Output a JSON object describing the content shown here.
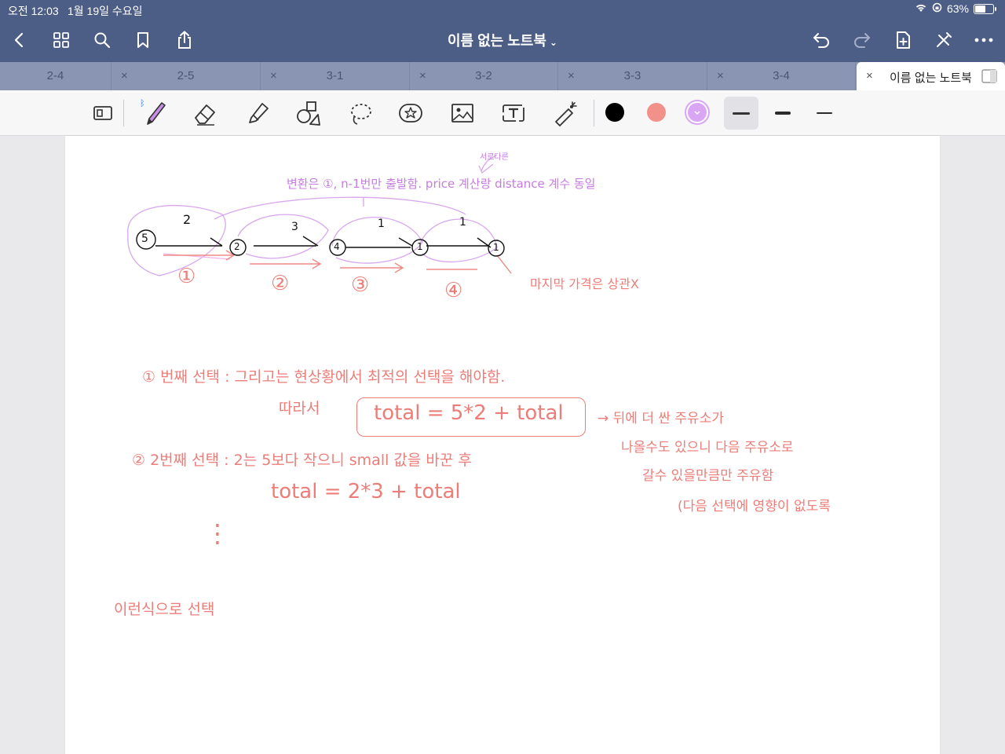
{
  "status_bar": {
    "time": "오전 12:03",
    "date": "1월 19일 수요일",
    "battery_text": "63%",
    "battery_level_percent": 63
  },
  "nav": {
    "title": "이름 없는 노트북",
    "title_chevron": "⌄",
    "icons": [
      "back-icon",
      "grid-icon",
      "search-icon",
      "bookmark-icon",
      "share-icon",
      "undo-icon",
      "redo-icon",
      "add-page-icon",
      "pen-off-icon",
      "more-icon"
    ]
  },
  "tabs": [
    {
      "label": "2-4",
      "active": false
    },
    {
      "label": "2-5",
      "active": false
    },
    {
      "label": "3-1",
      "active": false
    },
    {
      "label": "3-2",
      "active": false
    },
    {
      "label": "3-3",
      "active": false
    },
    {
      "label": "3-4",
      "active": false
    },
    {
      "label": "이름 없는 노트북",
      "active": true
    }
  ],
  "tab_close_glyph": "×",
  "toolbar": {
    "tools": [
      "page-layout",
      "pen",
      "eraser",
      "highlighter",
      "shapes",
      "lasso",
      "sticker",
      "image",
      "text",
      "laser-pointer"
    ],
    "selected_tool": "pen",
    "colors": [
      "#000000",
      "#f2908a",
      "#d8a6f3"
    ],
    "selected_color": "#d8a6f3",
    "stroke_widths": [
      "thick",
      "medium",
      "thin"
    ],
    "selected_stroke": "thick"
  },
  "notes": {
    "top_annotation_small": "서로다른",
    "top_annotation": "변환은 ①, n-1번만 출발함. price 계산랑 distance 계수 동일",
    "edge_weights": [
      "2",
      "3",
      "1",
      "1"
    ],
    "node_values": [
      "5",
      "2",
      "4",
      "1",
      "1"
    ],
    "segment_labels": [
      "①",
      "②",
      "③",
      "④"
    ],
    "last_node_note": "마지막 가격은 상관X",
    "line1a": "① 번째 선택 :  그리고는 현상황에서 최적의 선택을 해야함.",
    "line1b": "따라서",
    "boxed_formula": "total = 5*2 + total",
    "side_note_1": "→ 뒤에 더 싼 주유소가",
    "side_note_2": "나올수도 있으니 다음 주유소로",
    "side_note_3": "갈수 있을만큼만 주유함",
    "side_note_4": "(다음 선택에 영향이 없도록",
    "line2a": "② 2번째 선택 :  2는 5보다 작으니 small 값을 바꾼 후",
    "line2b": "total = 2*3 + total",
    "dots": "⋮",
    "closing": "이런식으로 선택"
  }
}
